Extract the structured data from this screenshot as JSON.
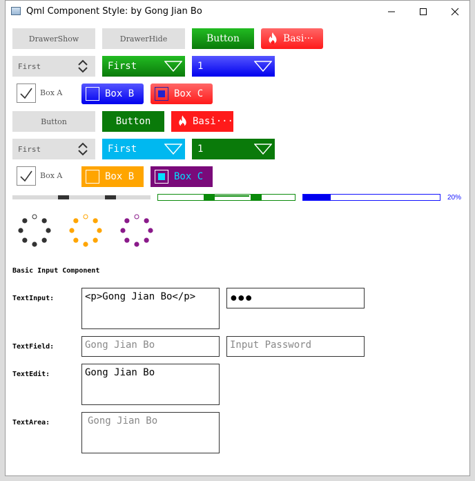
{
  "window": {
    "title": "Qml Component Style: by Gong Jian Bo"
  },
  "row1": {
    "drawer_show": "DrawerShow",
    "drawer_hide": "DrawerHide",
    "button": "Button",
    "basic": "Basi···"
  },
  "row2": {
    "combo_gray": "First",
    "combo_green": "First",
    "combo_blue": "1"
  },
  "row3": {
    "box_a": "Box A",
    "box_b": "Box B",
    "box_c": "Box C"
  },
  "row4": {
    "button_gray": "Button",
    "button_green": "Button",
    "basic": "Basi···"
  },
  "row5": {
    "combo_gray": "First",
    "combo_cyan": "First",
    "combo_green": "1"
  },
  "row6": {
    "box_a": "Box A",
    "box_b": "Box B",
    "box_c": "Box C"
  },
  "progress": {
    "percent_text": "20%",
    "value": 0.2
  },
  "section_title": "Basic Input Component",
  "inputs": {
    "textinput_label": "TextInput:",
    "textinput_value": "<p>Gong Jian Bo</p>",
    "password_dots": "●●●",
    "textfield_label": "TextField:",
    "textfield_placeholder": "Gong Jian Bo",
    "password_placeholder": "Input Password",
    "textedit_label": "TextEdit:",
    "textedit_value": "Gong Jian Bo",
    "textarea_label": "TextArea:",
    "textarea_placeholder": "Gong Jian Bo"
  },
  "colors": {
    "green": "#0a8a0a",
    "blue": "#1010ff",
    "red": "#ff1a1a",
    "orange": "#ffa500",
    "purple": "#7a0a7a",
    "cyan": "#00b8f0"
  },
  "icons": {
    "fire": "fire-icon",
    "check": "check-icon",
    "minimize": "minimize-icon",
    "maximize": "maximize-icon",
    "close": "close-icon"
  }
}
